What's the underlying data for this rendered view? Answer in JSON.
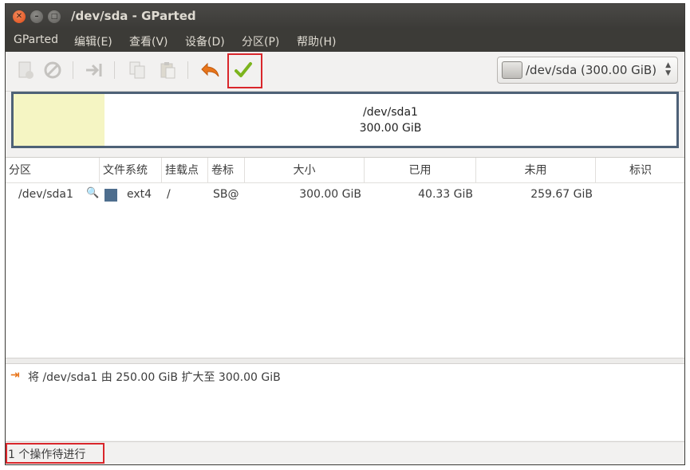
{
  "window": {
    "title": "/dev/sda - GParted"
  },
  "menubar": [
    {
      "label": "GParted"
    },
    {
      "label": "编辑(E)"
    },
    {
      "label": "查看(V)"
    },
    {
      "label": "设备(D)"
    },
    {
      "label": "分区(P)"
    },
    {
      "label": "帮助(H)"
    }
  ],
  "toolbar": {
    "new_icon": "new-partition-icon",
    "delete_icon": "delete-icon",
    "resize_icon": "resize-move-icon",
    "copy_icon": "copy-icon",
    "paste_icon": "paste-icon",
    "undo_icon": "undo-icon",
    "apply_icon": "apply-checkmark-icon",
    "device_selector": "/dev/sda  (300.00 GiB)"
  },
  "disk_map": {
    "partition_name": "/dev/sda1",
    "partition_size": "300.00 GiB"
  },
  "table": {
    "headers": {
      "partition": "分区",
      "filesystem": "文件系统",
      "mountpoint": "挂载点",
      "label": "卷标",
      "size": "大小",
      "used": "已用",
      "unused": "未用",
      "flags": "标识"
    },
    "rows": [
      {
        "partition": "/dev/sda1",
        "filesystem": "ext4",
        "mountpoint": "/",
        "label": "SB@",
        "size": "300.00 GiB",
        "used": "40.33 GiB",
        "unused": "259.67 GiB",
        "flags": ""
      }
    ]
  },
  "operations": [
    {
      "text": "将 /dev/sda1 由 250.00 GiB 扩大至 300.00 GiB"
    }
  ],
  "statusbar": {
    "text": "1 个操作待进行"
  },
  "colors": {
    "ext4": "#4e6e8e",
    "unallocated": "#f5f5c3",
    "highlight": "#d9262b",
    "titlebar": "#3c3b37"
  }
}
